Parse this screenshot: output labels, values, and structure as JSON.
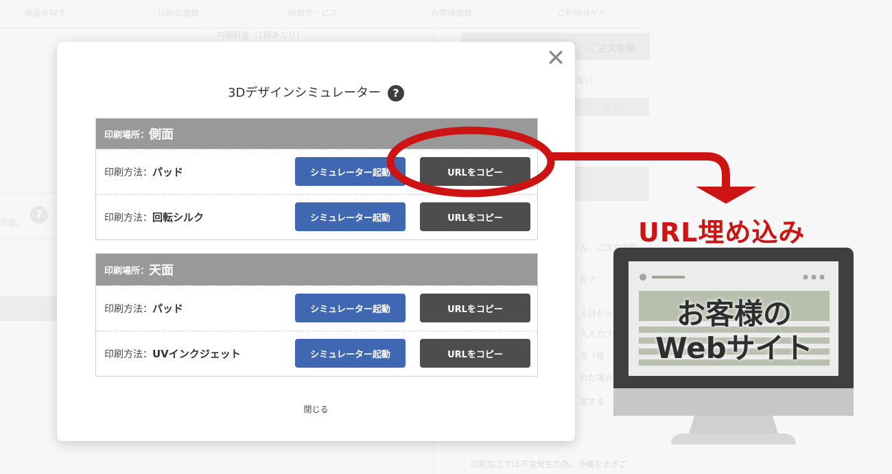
{
  "background": {
    "nav": [
      "商品を探す",
      "印刷の種類",
      "納期サービス",
      "お客様情報",
      "ご利用ガイド"
    ],
    "fragments": [
      "内職料金（1個あたり）",
      "ご注文金額",
      "ない",
      "合計",
      "可能。",
      "ん。ご注文内容",
      "日ナ",
      "人日から",
      "入入力フ",
      "与「号",
      "れた場合",
      "定する",
      "印刷加工では不良発生の為、予備をまぎご"
    ]
  },
  "modal": {
    "title": "3Dデザインシミュレーター",
    "help_glyph": "?",
    "close_glyph": "✕",
    "close_link": "閉じる",
    "sections": [
      {
        "location_label": "印刷場所：",
        "location_value": "側面",
        "rows": [
          {
            "method_label": "印刷方法：",
            "method_value": "パッド",
            "sim_label": "シミュレーター起動",
            "copy_label": "URLをコピー"
          },
          {
            "method_label": "印刷方法：",
            "method_value": "回転シルク",
            "sim_label": "シミュレーター起動",
            "copy_label": "URLをコピー"
          }
        ]
      },
      {
        "location_label": "印刷場所：",
        "location_value": "天面",
        "rows": [
          {
            "method_label": "印刷方法：",
            "method_value": "パッド",
            "sim_label": "シミュレーター起動",
            "copy_label": "URLをコピー"
          },
          {
            "method_label": "印刷方法：",
            "method_value": "UVインクジェット",
            "sim_label": "シミュレーター起動",
            "copy_label": "URLをコピー"
          }
        ]
      }
    ]
  },
  "annotation": {
    "embed_label": "URL埋め込み",
    "site_line1": "お客様の",
    "site_line2": "Webサイト",
    "accent_color": "#cc1414"
  },
  "colors": {
    "sim_button": "#4068b2",
    "copy_button": "#4d4d4d",
    "section_header": "#999999"
  }
}
